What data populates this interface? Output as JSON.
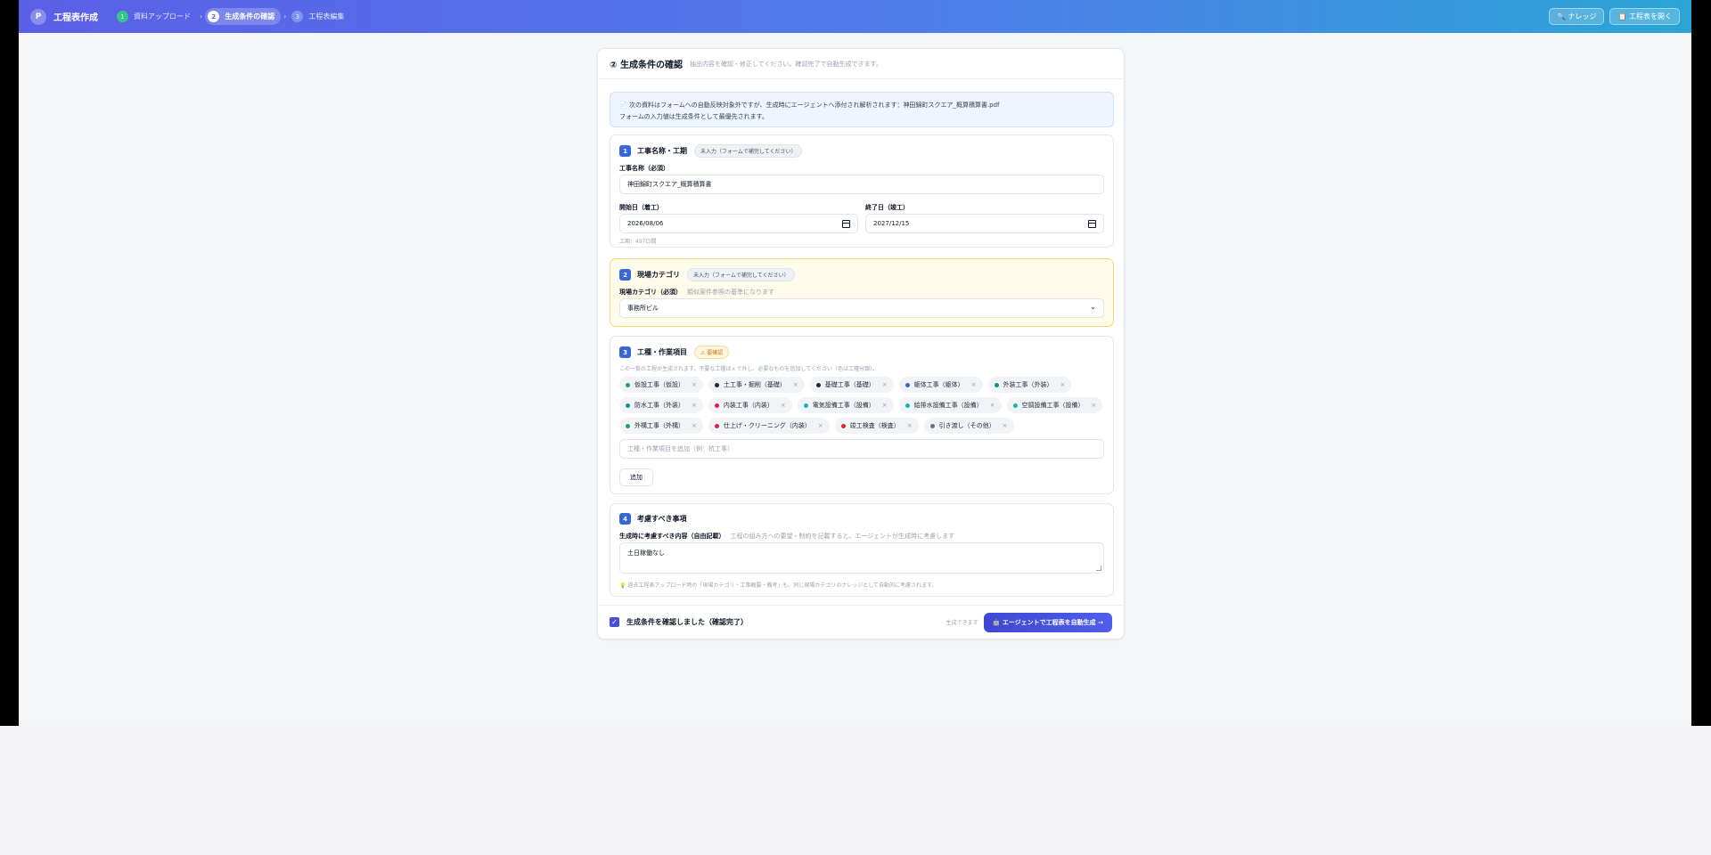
{
  "header": {
    "logo": "P",
    "app_title": "工程表作成",
    "steps": [
      {
        "num": "1",
        "label": "資料アップロード"
      },
      {
        "num": "2",
        "label": "生成条件の確認"
      },
      {
        "num": "3",
        "label": "工程表編集"
      }
    ],
    "separator": "›",
    "knowledge_button": "🔍 ナレッジ",
    "open_button": "📋 工程表を開く"
  },
  "card": {
    "title": "② 生成条件の確認",
    "subtitle": "抽出内容を確認・修正してください。確認完了で自動生成できます。",
    "info_line1": "📄 次の資料はフォームへの自動反映対象外ですが、生成時にエージェントへ添付され解析されます：神田錦町スクエア_概算積算書.pdf",
    "info_line2": "フォームの入力値は生成条件として最優先されます。"
  },
  "section1": {
    "num": "1",
    "title": "工事名称・工期",
    "pill": "未入力（フォームで補完してください）",
    "name_label": "工事名称（必須）",
    "name_value": "神田錦町スクエア_概算積算書",
    "start_label": "開始日（着工）",
    "start_value": "2026/08/06",
    "end_label": "終了日（竣工）",
    "end_value": "2027/12/15",
    "duration": "工期：497日間"
  },
  "section2": {
    "num": "2",
    "title": "現場カテゴリ",
    "pill": "未入力（フォームで補完してください）",
    "label": "現場カテゴリ（必須）",
    "hint": "類似案件参照の基準になります",
    "value": "事務所ビル",
    "chevron": "⌄"
  },
  "section3": {
    "num": "3",
    "title": "工種・作業項目",
    "pill": "⚠ 要確認",
    "description": "この一覧の工程が生成されます。不要な工種はｘで外し、必要なものを追加してください（色は工種分類）。",
    "remove_symbol": "×",
    "chips": [
      {
        "label": "仮設工事（仮設）",
        "color": "#22a06b"
      },
      {
        "label": "土工事・掘削（基礎）",
        "color": "#1f2937"
      },
      {
        "label": "基礎工事（基礎）",
        "color": "#1f2937"
      },
      {
        "label": "躯体工事（躯体）",
        "color": "#3b66d8"
      },
      {
        "label": "外装工事（外装）",
        "color": "#0d9488"
      },
      {
        "label": "防水工事（外装）",
        "color": "#0d9488"
      },
      {
        "label": "内装工事（内装）",
        "color": "#e11d48"
      },
      {
        "label": "電気設備工事（設備）",
        "color": "#14b8a6"
      },
      {
        "label": "給排水設備工事（設備）",
        "color": "#14b8a6"
      },
      {
        "label": "空調設備工事（設備）",
        "color": "#14b8a6"
      },
      {
        "label": "外構工事（外構）",
        "color": "#22a06b"
      },
      {
        "label": "仕上げ・クリーニング（内装）",
        "color": "#e11d48"
      },
      {
        "label": "竣工検査（検査）",
        "color": "#dc2626"
      },
      {
        "label": "引き渡し（その他）",
        "color": "#6b7280"
      }
    ],
    "add_placeholder": "工種・作業項目を追加（例：杭工事）",
    "add_button": "追加"
  },
  "section4": {
    "num": "4",
    "title": "考慮すべき事項",
    "label": "生成時に考慮すべき内容（自由記載）",
    "hint": "工程の組み方への要望・制約を記載すると、エージェントが生成時に考慮します",
    "value": "土日稼働なし",
    "note": "💡 過去工程表アップロード時の「現場カテゴリ・工事概要・備考」も、同じ現場カテゴリのナレッジとして自動的に考慮されます。"
  },
  "footer": {
    "checkbox_label": "生成条件を確認しました（確認完了）",
    "check_mark": "✓",
    "ready_hint": "生成できます",
    "generate_button": "🤖 エージェントで工程表を自動生成 →"
  }
}
